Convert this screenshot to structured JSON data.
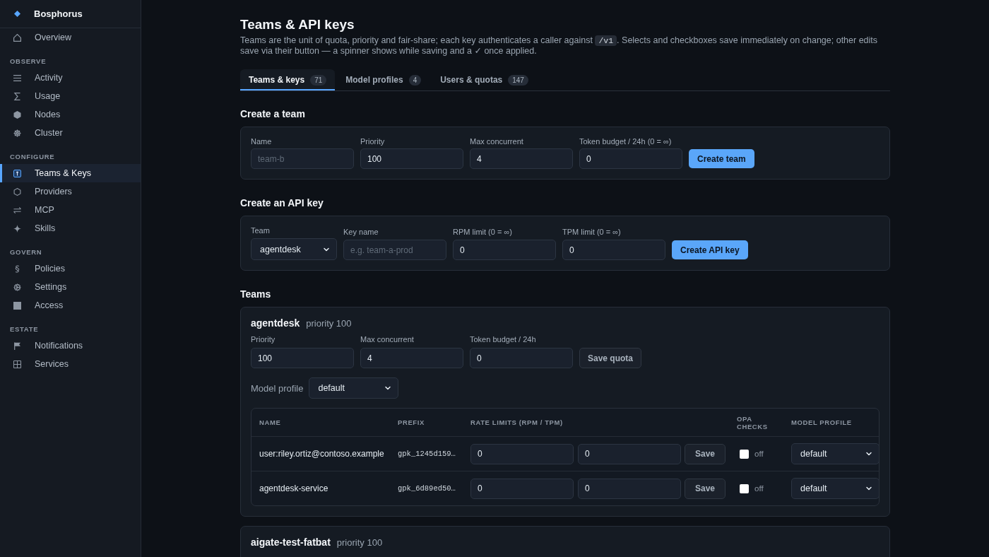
{
  "sidebar": {
    "brand": "Bosphorus",
    "items": [
      {
        "label": "Overview",
        "selected": false
      }
    ],
    "sections": [
      {
        "title": "OBSERVE",
        "items": [
          {
            "label": "Activity",
            "selected": false
          },
          {
            "label": "Usage",
            "selected": false
          },
          {
            "label": "Nodes",
            "selected": false
          },
          {
            "label": "Cluster",
            "selected": false
          }
        ]
      },
      {
        "title": "CONFIGURE",
        "items": [
          {
            "label": "Teams & Keys",
            "selected": true
          },
          {
            "label": "Providers",
            "selected": false
          },
          {
            "label": "MCP",
            "selected": false
          },
          {
            "label": "Skills",
            "selected": false
          }
        ]
      },
      {
        "title": "GOVERN",
        "items": [
          {
            "label": "Policies",
            "selected": false
          },
          {
            "label": "Settings",
            "selected": false
          },
          {
            "label": "Access",
            "selected": false
          }
        ]
      },
      {
        "title": "ESTATE",
        "items": [
          {
            "label": "Notifications",
            "selected": false
          },
          {
            "label": "Services",
            "selected": false
          }
        ]
      }
    ]
  },
  "page": {
    "title": "Teams & API keys",
    "description": {
      "before": "Teams are the unit of quota, priority and fair-share; each key authenticates a caller against ",
      "code": "/v1",
      "after": ". Selects and checkboxes save immediately on change; other edits save via their button — a spinner shows while saving and a ✓ once applied."
    }
  },
  "tabs": [
    {
      "label": "Teams & keys",
      "count": "71",
      "selected": true
    },
    {
      "label": "Model profiles",
      "count": "4",
      "selected": false
    },
    {
      "label": "Users & quotas",
      "count": "147",
      "selected": false
    }
  ],
  "create_team": {
    "heading": "Create a team",
    "fields": [
      {
        "kind": "input",
        "label": "Name",
        "placeholder": "team-b"
      },
      {
        "kind": "input",
        "label": "Priority",
        "value": "100"
      },
      {
        "kind": "input",
        "label": "Max concurrent",
        "value": "4"
      },
      {
        "kind": "input",
        "label": "Token budget / 24h (0 = ∞)",
        "value": "0"
      }
    ],
    "button": "Create team"
  },
  "create_key": {
    "heading": "Create an API key",
    "fields": [
      {
        "kind": "select",
        "label": "Team",
        "value": "agentdesk"
      },
      {
        "kind": "input",
        "label": "Key name",
        "placeholder": "e.g. team-a-prod"
      },
      {
        "kind": "input",
        "label": "RPM limit (0 = ∞)",
        "value": "0"
      },
      {
        "kind": "input",
        "label": "TPM limit (0 = ∞)",
        "value": "0"
      }
    ],
    "button": "Create API key"
  },
  "teams": {
    "heading": "Teams",
    "items": [
      {
        "name": "agentdesk",
        "priority": "priority 100",
        "fields": [
          {
            "kind": "input",
            "label": "Priority",
            "value": "100"
          },
          {
            "kind": "input",
            "label": "Max concurrent",
            "value": "4"
          },
          {
            "kind": "input",
            "label": "Token budget / 24h",
            "value": "0"
          }
        ],
        "save_button": "Save quota",
        "model_profile": {
          "label": "Model profile",
          "value": "default"
        },
        "keys": {
          "columns": [
            "NAME",
            "PREFIX",
            "RATE LIMITS (RPM / TPM)",
            "OPA CHECKS",
            "MODEL PROFILE"
          ],
          "rows": [
            {
              "name": "user:riley.ortiz@contoso.example",
              "prefix": "gpk_1245d159…",
              "rpm": "0",
              "tpm": "0",
              "save": "Save",
              "opa_checked": false,
              "opa_label": "off",
              "model_profile": "default"
            },
            {
              "name": "agentdesk-service",
              "prefix": "gpk_6d89ed50…",
              "rpm": "0",
              "tpm": "0",
              "save": "Save",
              "opa_checked": false,
              "opa_label": "off",
              "model_profile": "default"
            }
          ]
        }
      },
      {
        "name": "aigate-test-fatbat",
        "priority": "priority 100"
      }
    ]
  }
}
